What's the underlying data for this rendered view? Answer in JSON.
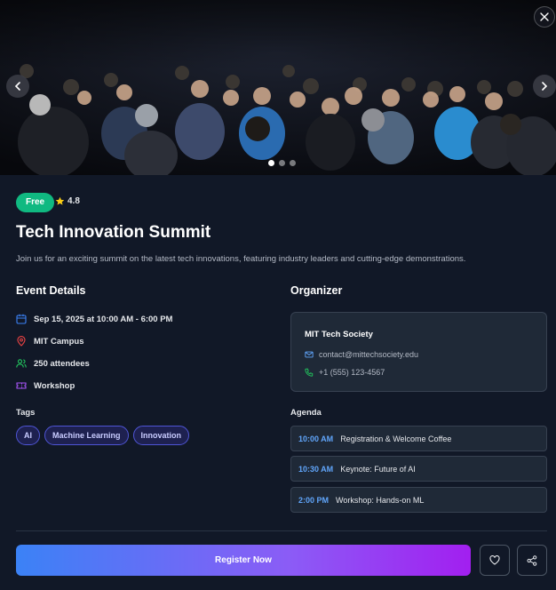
{
  "hero": {
    "image_description_icon": "photo-audience",
    "slide_count": 3,
    "active_slide": 1
  },
  "badge": {
    "label": "Free",
    "color": "#10b981"
  },
  "rating": {
    "value": "4.8",
    "icon": "star-icon"
  },
  "event": {
    "title": "Tech Innovation Summit",
    "description": "Join us for an exciting summit on the latest tech innovations, featuring industry leaders and cutting-edge demonstrations."
  },
  "details": {
    "heading": "Event Details",
    "date": "Sep 15, 2025 at 10:00 AM - 6:00 PM",
    "location": "MIT Campus",
    "attendees": "250 attendees",
    "type": "Workshop"
  },
  "tags": {
    "heading": "Tags",
    "items": [
      "AI",
      "Machine Learning",
      "Innovation"
    ]
  },
  "organizer": {
    "heading": "Organizer",
    "name": "MIT Tech Society",
    "email": "contact@mittechsociety.edu",
    "phone": "+1 (555) 123-4567"
  },
  "agenda": {
    "heading": "Agenda",
    "items": [
      {
        "time": "10:00 AM",
        "title": "Registration & Welcome Coffee"
      },
      {
        "time": "10:30 AM",
        "title": "Keynote: Future of AI"
      },
      {
        "time": "2:00 PM",
        "title": "Workshop: Hands-on ML"
      }
    ]
  },
  "actions": {
    "register_label": "Register Now",
    "favorite_icon": "heart-icon",
    "share_icon": "share-icon"
  },
  "colors": {
    "accent_blue": "#3b82f6",
    "accent_purple": "#a21ff0",
    "background": "#111827",
    "card": "#1f2937"
  }
}
